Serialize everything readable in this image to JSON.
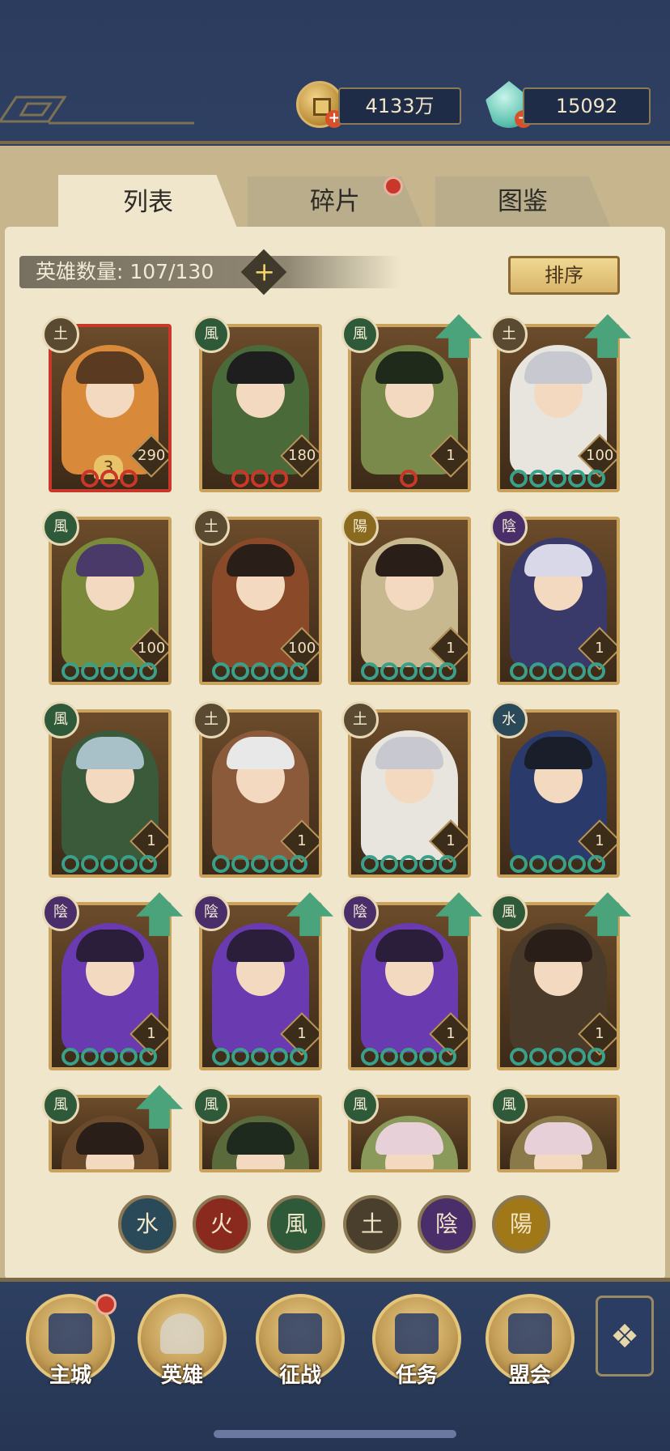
{
  "resources": {
    "gold": "4133万",
    "jade": "15092",
    "plus": "+"
  },
  "tabs": [
    {
      "label": "列表",
      "active": true
    },
    {
      "label": "碎片",
      "active": false,
      "badge": true
    },
    {
      "label": "图鉴",
      "active": false
    }
  ],
  "roster": {
    "count_label": "英雄数量: 107/130",
    "add": "+",
    "sort_label": "排序"
  },
  "heroes": [
    {
      "element": "土",
      "level": "290",
      "stars": 3,
      "star_color": "#c8382a",
      "badge": "3",
      "upgrade": false,
      "hair": "#5a3a20",
      "bg": "#d88a3a"
    },
    {
      "element": "風",
      "level": "180",
      "stars": 3,
      "star_color": "#c8382a",
      "upgrade": false,
      "hair": "#1e1e1e",
      "bg": "#4a6a3a"
    },
    {
      "element": "風",
      "level": "1",
      "stars": 1,
      "star_color": "#c8382a",
      "upgrade": true,
      "hair": "#1f2a1a",
      "bg": "#7a8a4a"
    },
    {
      "element": "土",
      "level": "100",
      "stars": 5,
      "star_color": "#3aa08a",
      "upgrade": true,
      "hair": "#c8c8d0",
      "bg": "#e8e4de"
    },
    {
      "element": "風",
      "level": "100",
      "stars": 5,
      "star_color": "#3aa08a",
      "upgrade": false,
      "hair": "#4a3a6a",
      "bg": "#7a8a3a"
    },
    {
      "element": "土",
      "level": "100",
      "stars": 5,
      "star_color": "#3aa08a",
      "upgrade": false,
      "hair": "#2a1e18",
      "bg": "#8a4a2a"
    },
    {
      "element": "陽",
      "level": "1",
      "stars": 5,
      "star_color": "#3aa08a",
      "upgrade": false,
      "hair": "#2a1e18",
      "bg": "#c8b890"
    },
    {
      "element": "陰",
      "level": "1",
      "stars": 5,
      "star_color": "#3aa08a",
      "upgrade": false,
      "hair": "#d8d8e8",
      "bg": "#3a3a6a"
    },
    {
      "element": "風",
      "level": "1",
      "stars": 5,
      "star_color": "#3aa08a",
      "upgrade": false,
      "hair": "#a8c0c8",
      "bg": "#3a5a3a"
    },
    {
      "element": "土",
      "level": "1",
      "stars": 5,
      "star_color": "#3aa08a",
      "upgrade": false,
      "hair": "#e8e8e8",
      "bg": "#8a5a3a"
    },
    {
      "element": "土",
      "level": "1",
      "stars": 5,
      "star_color": "#3aa08a",
      "upgrade": false,
      "hair": "#c8c8d0",
      "bg": "#e8e4de"
    },
    {
      "element": "水",
      "level": "1",
      "stars": 5,
      "star_color": "#3aa08a",
      "upgrade": false,
      "hair": "#1a1e2a",
      "bg": "#2a3a6a"
    },
    {
      "element": "陰",
      "level": "1",
      "stars": 5,
      "star_color": "#3aa08a",
      "upgrade": true,
      "hair": "#2a1e3a",
      "bg": "#6a3ab0"
    },
    {
      "element": "陰",
      "level": "1",
      "stars": 5,
      "star_color": "#3aa08a",
      "upgrade": true,
      "hair": "#2a1e3a",
      "bg": "#6a3ab0"
    },
    {
      "element": "陰",
      "level": "1",
      "stars": 5,
      "star_color": "#3aa08a",
      "upgrade": true,
      "hair": "#2a1e3a",
      "bg": "#6a3ab0"
    },
    {
      "element": "風",
      "level": "1",
      "stars": 5,
      "star_color": "#3aa08a",
      "upgrade": true,
      "hair": "#2a1e18",
      "bg": "#4a3a2a"
    },
    {
      "element": "風",
      "upgrade": true,
      "hair": "#2a1e18",
      "bg": "#6a4a2a"
    },
    {
      "element": "風",
      "upgrade": false,
      "hair": "#1e2a1e",
      "bg": "#5a6a3a"
    },
    {
      "element": "風",
      "upgrade": false,
      "hair": "#e8d0d8",
      "bg": "#8a9a5a"
    },
    {
      "element": "風",
      "upgrade": false,
      "hair": "#e8d0d8",
      "bg": "#8a7a4a"
    }
  ],
  "element_colors": {
    "土": "#5a4a32",
    "風": "#2f5a3a",
    "陽": "#8a6a1e",
    "陰": "#4a2e6a",
    "水": "#2a4a5a",
    "火": "#8a2a1e"
  },
  "filters": [
    {
      "label": "水",
      "color": "#2a4a5a"
    },
    {
      "label": "火",
      "color": "#8a2a1e"
    },
    {
      "label": "風",
      "color": "#2f5a3a"
    },
    {
      "label": "土",
      "color": "#4a3e2c"
    },
    {
      "label": "陰",
      "color": "#4a2e6a"
    },
    {
      "label": "陽",
      "color": "#a07818"
    }
  ],
  "nav": [
    {
      "label": "主城",
      "badge": true,
      "active": false
    },
    {
      "label": "英雄",
      "badge": false,
      "active": true
    },
    {
      "label": "征战",
      "badge": false,
      "active": false
    },
    {
      "label": "任务",
      "badge": false,
      "active": false
    },
    {
      "label": "盟会",
      "badge": false,
      "active": false
    }
  ],
  "menu_icon": "❖"
}
